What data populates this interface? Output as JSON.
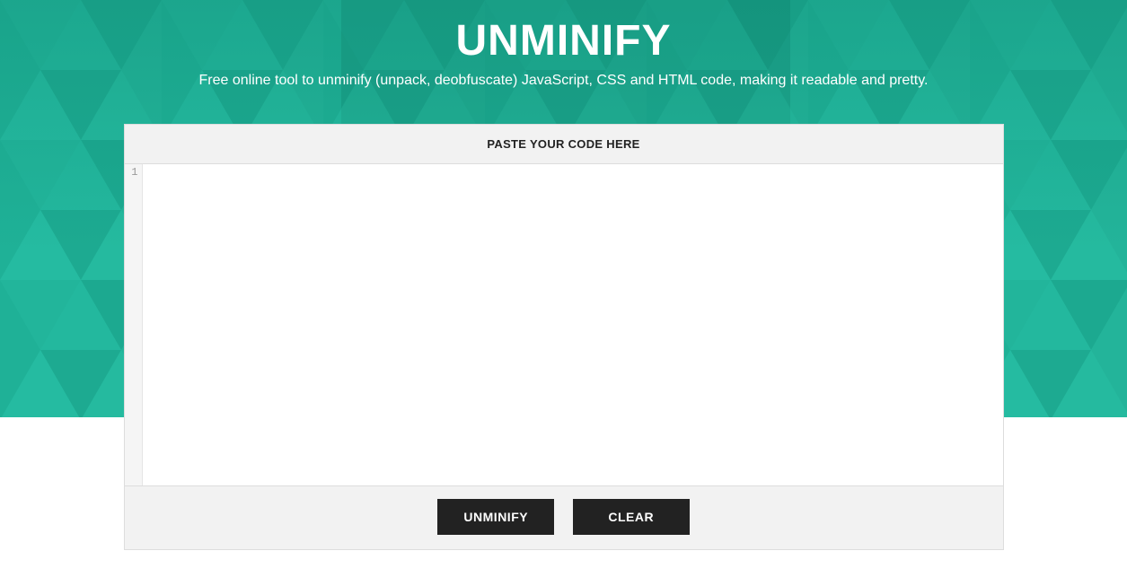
{
  "hero": {
    "title": "UNMINIFY",
    "subtitle": "Free online tool to unminify (unpack, deobfuscate) JavaScript, CSS and HTML code, making it readable and pretty."
  },
  "editor": {
    "header": "PASTE YOUR CODE HERE",
    "line_number": "1",
    "value": ""
  },
  "actions": {
    "unminify": "UNMINIFY",
    "clear": "CLEAR"
  }
}
